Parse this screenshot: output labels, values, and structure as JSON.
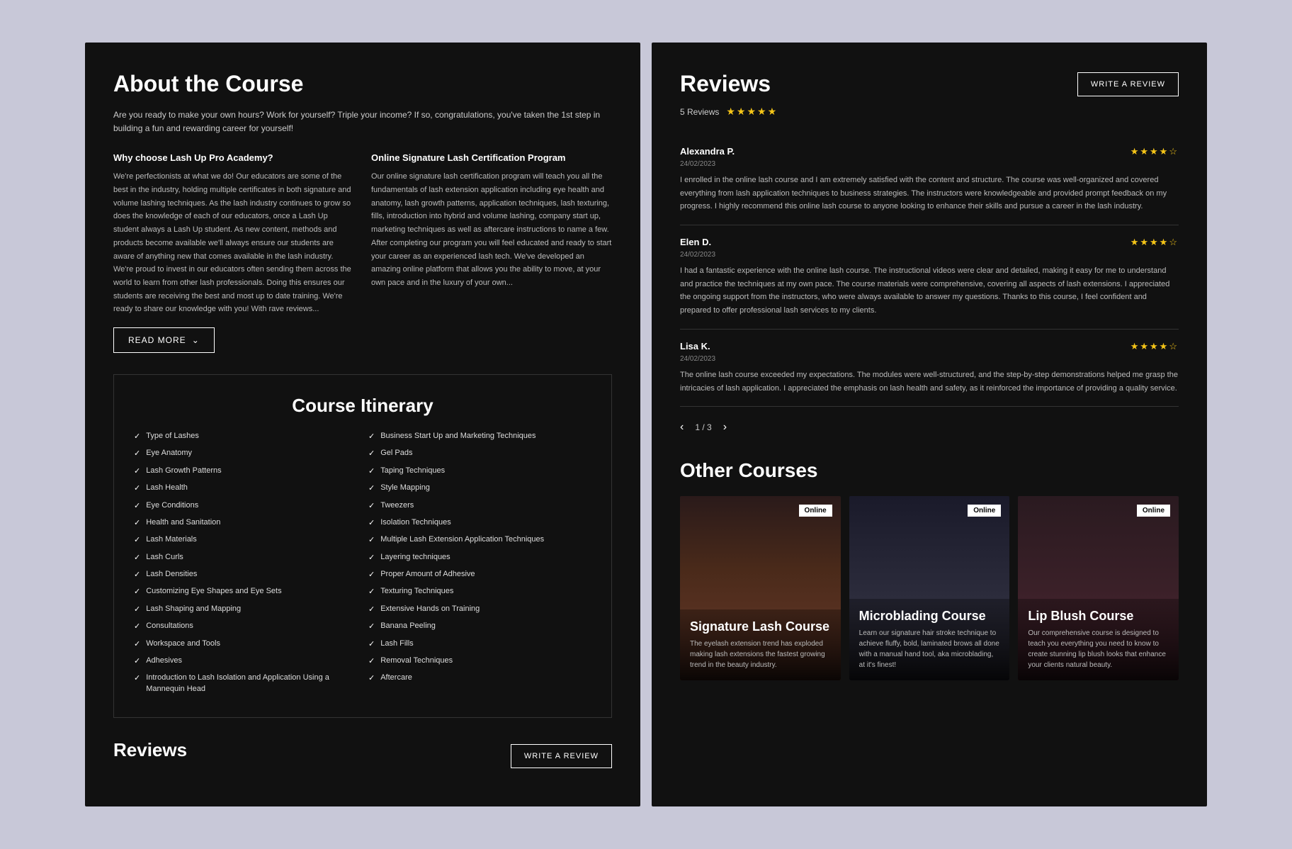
{
  "left": {
    "about": {
      "title": "About the Course",
      "intro": "Are you ready to make your own hours? Work for yourself? Triple your income? If so, congratulations, you've taken the 1st step in building a fun and rewarding career for yourself!",
      "why_heading": "Why choose Lash Up Pro Academy?",
      "why_body": "We're perfectionists at what we do! Our educators are some of the best in the industry, holding multiple certificates in both signature and volume lashing techniques. As the lash industry continues to grow so does the knowledge of each of our educators, once a Lash Up student always a Lash Up student. As new content, methods and products become available we'll always ensure our students are aware of anything new that comes available in the lash industry. We're proud to invest in our educators often sending them across the world to learn from other lash professionals. Doing this ensures our students are receiving the best and most up to date training. We're ready to share our knowledge with you! With rave reviews...",
      "online_heading": "Online Signature Lash Certification Program",
      "online_body": "Our online signature lash certification program will teach you all the fundamentals of lash extension application including eye health and anatomy, lash growth patterns, application techniques, lash texturing, fills, introduction into hybrid and volume lashing, company start up, marketing techniques as well as aftercare instructions to name a few. After completing our program you will feel educated and ready to start your career as an experienced lash tech.\n\nWe've developed an amazing online platform that allows you the ability to move, at your own pace and in the luxury of your own..."
    },
    "read_more_btn": "READ MORE",
    "itinerary": {
      "title": "Course Itinerary",
      "left_items": [
        "Type of Lashes",
        "Eye Anatomy",
        "Lash Growth Patterns",
        "Lash Health",
        "Eye Conditions",
        "Health and Sanitation",
        "Lash Materials",
        "Lash Curls",
        "Lash Densities",
        "Customizing Eye Shapes and Eye Sets",
        "Lash Shaping and Mapping",
        "Consultations",
        "Workspace and Tools",
        "Adhesives",
        "Introduction to Lash Isolation and Application Using a Mannequin Head"
      ],
      "right_items": [
        "Business Start Up and Marketing Techniques",
        "Gel Pads",
        "Taping Techniques",
        "Style Mapping",
        "Tweezers",
        "Isolation Techniques",
        "Multiple Lash Extension Application Techniques",
        "Layering techniques",
        "Proper Amount of Adhesive",
        "Texturing Techniques",
        "Extensive Hands on Training",
        "Banana Peeling",
        "Lash Fills",
        "Removal Techniques",
        "Aftercare"
      ]
    },
    "reviews_bottom_title": "Reviews",
    "write_review_btn_bottom": "WRITE A REVIEW"
  },
  "right": {
    "reviews": {
      "title": "Reviews",
      "count": "5 Reviews",
      "stars_display": "★★★★★",
      "write_btn": "WRITE A REVIEW",
      "items": [
        {
          "name": "Alexandra P.",
          "date": "24/02/2023",
          "stars": "★★★★☆",
          "text": "I enrolled in the online lash course and I am extremely satisfied with the content and structure. The course was well-organized and covered everything from lash application techniques to business strategies. The instructors were knowledgeable and provided prompt feedback on my progress. I highly recommend this online lash course to anyone looking to enhance their skills and pursue a career in the lash industry."
        },
        {
          "name": "Elen D.",
          "date": "24/02/2023",
          "stars": "★★★★☆",
          "text": "I had a fantastic experience with the online lash course. The instructional videos were clear and detailed, making it easy for me to understand and practice the techniques at my own pace. The course materials were comprehensive, covering all aspects of lash extensions. I appreciated the ongoing support from the instructors, who were always available to answer my questions. Thanks to this course, I feel confident and prepared to offer professional lash services to my clients."
        },
        {
          "name": "Lisa K.",
          "date": "24/02/2023",
          "stars": "★★★★☆",
          "text": "The online lash course exceeded my expectations. The modules were well-structured, and the step-by-step demonstrations helped me grasp the intricacies of lash application. I appreciated the emphasis on lash health and safety, as it reinforced the importance of providing a quality service."
        }
      ],
      "pagination": {
        "current": 1,
        "total": 3
      }
    },
    "other_courses": {
      "title": "Other Courses",
      "cards": [
        {
          "badge": "Online",
          "name": "Signature Lash Course",
          "desc": "The eyelash extension trend has exploded making lash extensions the fastest growing trend in the beauty industry."
        },
        {
          "badge": "Online",
          "name": "Microblading Course",
          "desc": "Learn our signature hair stroke technique to achieve fluffy, bold, laminated brows all done with a manual hand tool, aka microblading, at it's finest!"
        },
        {
          "badge": "Online",
          "name": "Lip Blush Course",
          "desc": "Our comprehensive course is designed to teach you everything you need to know to create stunning lip blush looks that enhance your clients natural beauty."
        }
      ]
    }
  }
}
